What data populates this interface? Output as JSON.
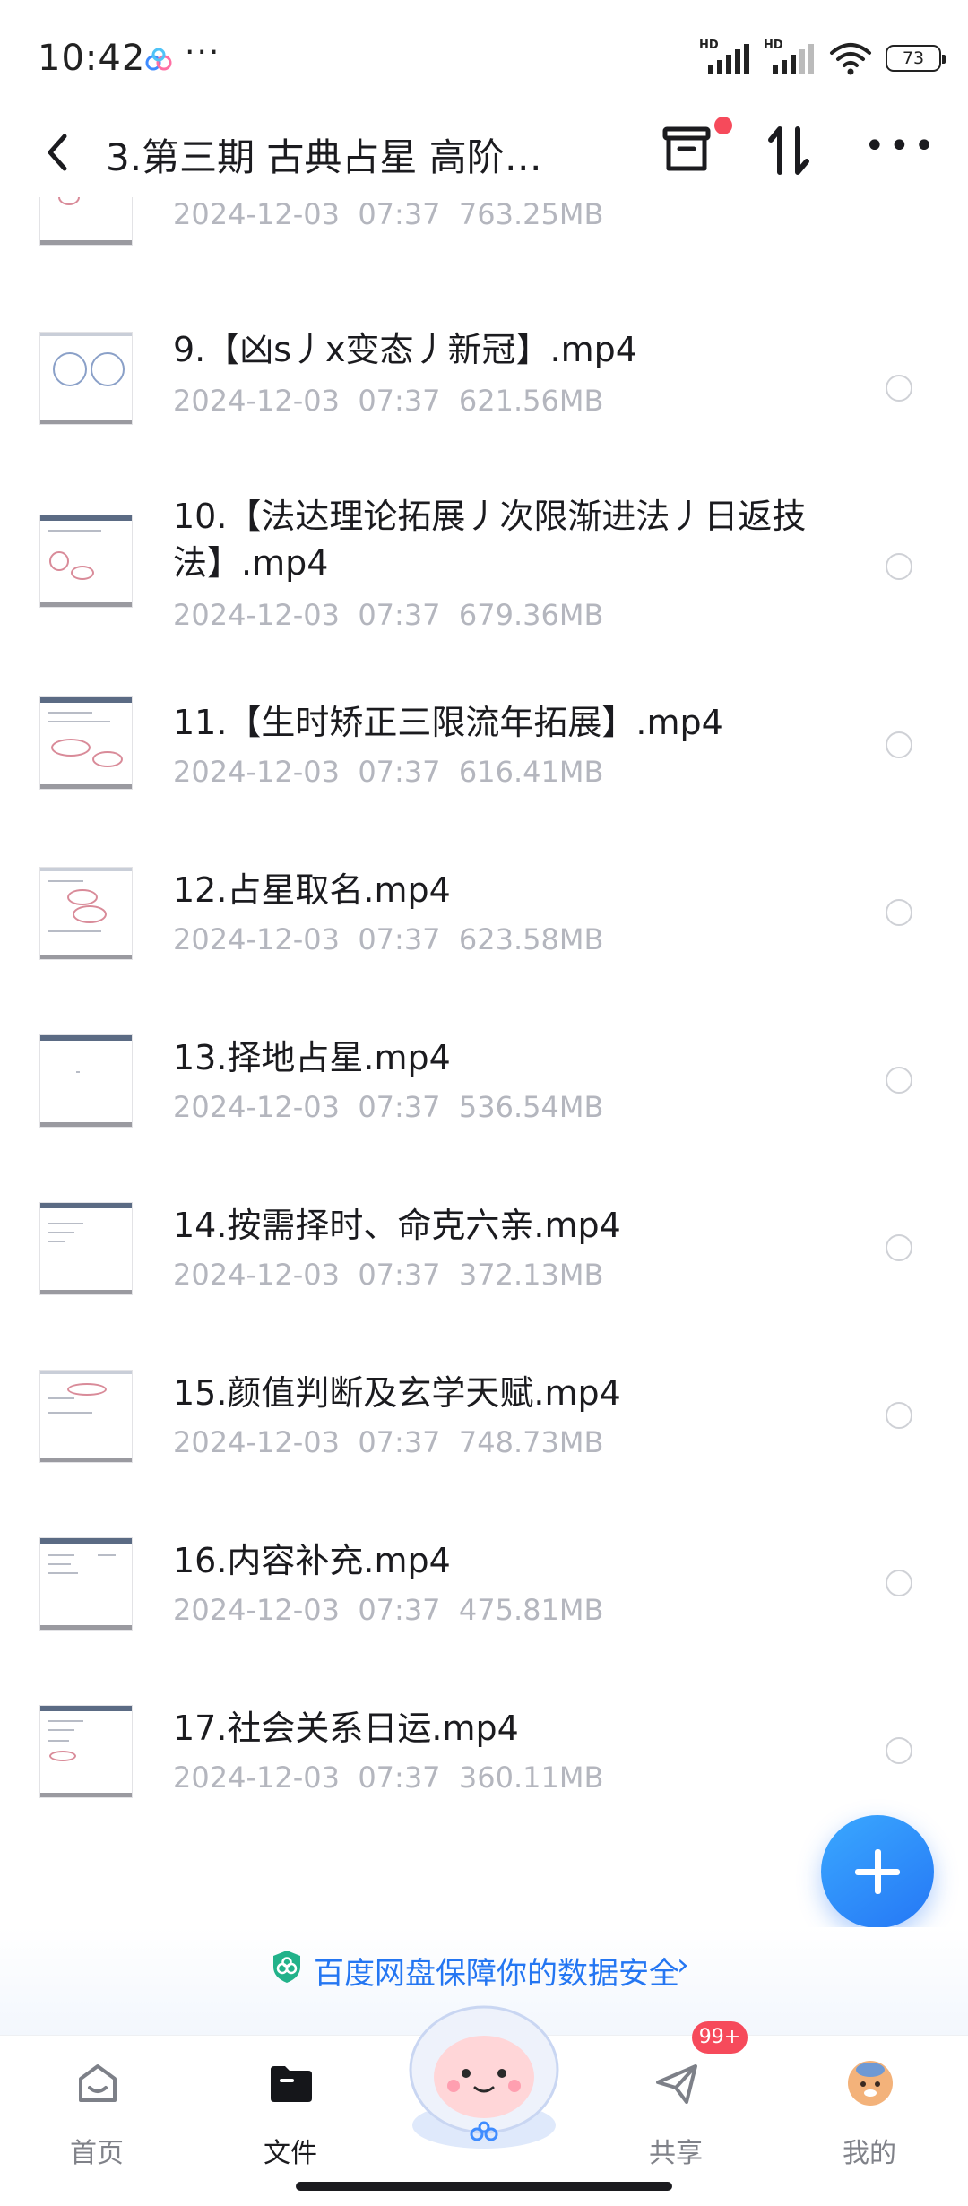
{
  "status": {
    "time": "10:42",
    "dots": "···",
    "hd1": "HD",
    "hd2": "HD",
    "battery": "73"
  },
  "header": {
    "title": "3.第三期 古典占星 高阶…"
  },
  "files": [
    {
      "name": "",
      "date": "2024-12-03",
      "time": "07:37",
      "size": "763.25MB"
    },
    {
      "name": "9.【凶s丿x变态丿新冠】.mp4",
      "date": "2024-12-03",
      "time": "07:37",
      "size": "621.56MB"
    },
    {
      "name": "10.【法达理论拓展丿次限渐进法丿日返技法】.mp4",
      "date": "2024-12-03",
      "time": "07:37",
      "size": "679.36MB"
    },
    {
      "name": "11.【生时矫正三限流年拓展】.mp4",
      "date": "2024-12-03",
      "time": "07:37",
      "size": "616.41MB"
    },
    {
      "name": "12.占星取名.mp4",
      "date": "2024-12-03",
      "time": "07:37",
      "size": "623.58MB"
    },
    {
      "name": "13.择地占星.mp4",
      "date": "2024-12-03",
      "time": "07:37",
      "size": "536.54MB"
    },
    {
      "name": "14.按需择时、命克六亲.mp4",
      "date": "2024-12-03",
      "time": "07:37",
      "size": "372.13MB"
    },
    {
      "name": "15.颜值判断及玄学天赋.mp4",
      "date": "2024-12-03",
      "time": "07:37",
      "size": "748.73MB"
    },
    {
      "name": "16.内容补充.mp4",
      "date": "2024-12-03",
      "time": "07:37",
      "size": "475.81MB"
    },
    {
      "name": "17.社会关系日运.mp4",
      "date": "2024-12-03",
      "time": "07:37",
      "size": "360.11MB"
    }
  ],
  "security": {
    "text": "百度网盘保障你的数据安全",
    "arrow": "›"
  },
  "nav": {
    "home": "首页",
    "files": "文件",
    "share": "共享",
    "share_badge": "99+",
    "mine": "我的"
  },
  "colors": {
    "accent": "#2476f2",
    "badge": "#f64a5b",
    "meta": "#b4b6be"
  }
}
